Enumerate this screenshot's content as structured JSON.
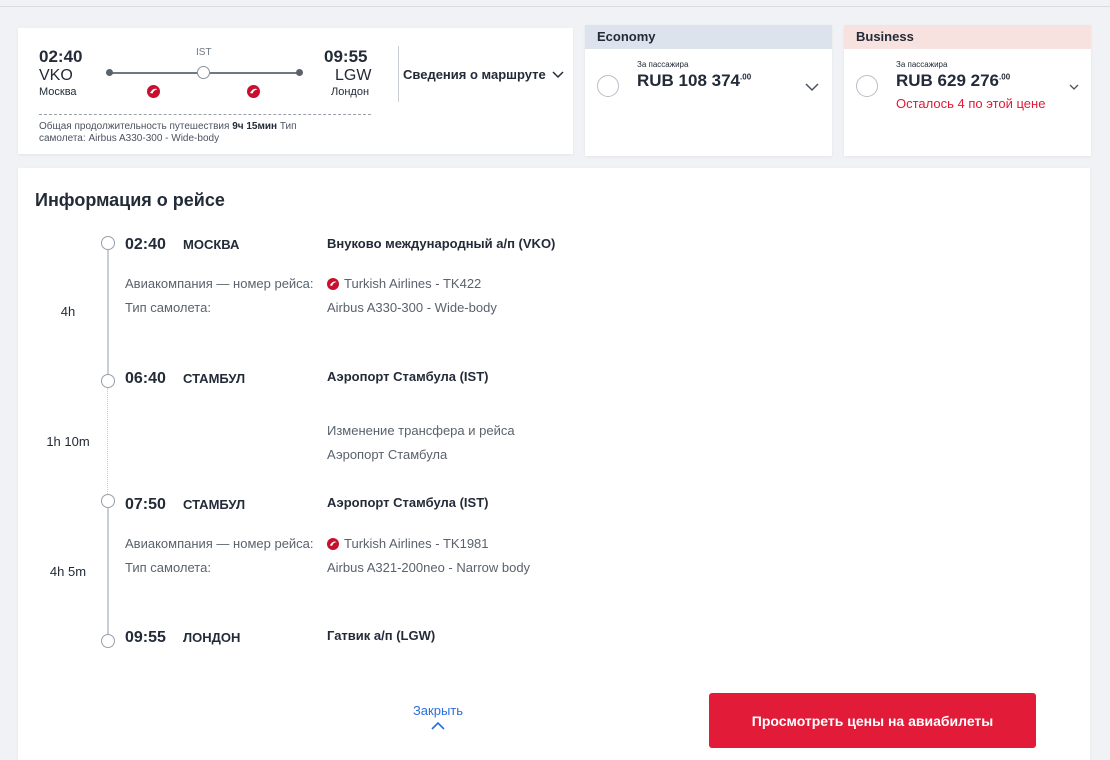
{
  "route": {
    "departure": {
      "time": "02:40",
      "code": "VKO",
      "city": "Москва"
    },
    "arrival": {
      "time": "09:55",
      "code": "LGW",
      "city": "Лондон"
    },
    "stop": "IST",
    "duration_label": "Общая продолжительность путешествия",
    "duration_value": "9ч 15мин",
    "aircraft_label": "Тип самолета:",
    "aircraft_value": "Airbus A330-300 - Wide-body",
    "details_label": "Сведения о маршруте"
  },
  "fares": {
    "economy": {
      "name": "Economy",
      "per_pax": "За пассажира",
      "price": "RUB 108 374",
      "cents": ".00"
    },
    "business": {
      "name": "Business",
      "per_pax": "За пассажира",
      "price": "RUB 629 276",
      "cents": ".00",
      "remaining": "Осталось 4 по этой цене"
    }
  },
  "info": {
    "title": "Информация о рейсе",
    "stops": [
      {
        "time": "02:40",
        "city": "Москва",
        "airport": "Внуково международный а/п (VKO)"
      },
      {
        "time": "06:40",
        "city": "Стамбул",
        "airport": "Аэропорт Стамбула (IST)"
      },
      {
        "time": "07:50",
        "city": "Стамбул",
        "airport": "Аэропорт Стамбула (IST)"
      },
      {
        "time": "09:55",
        "city": "Лондон",
        "airport": "Гатвик а/п (LGW)"
      }
    ],
    "segments": [
      {
        "duration": "4h",
        "airline_label": "Авиакомпания — номер рейса:",
        "airline": "Turkish Airlines - TK422",
        "aircraft_label": "Тип самолета:",
        "aircraft": "Airbus A330-300 - Wide-body"
      },
      {
        "duration": "4h 5m",
        "airline_label": "Авиакомпания — номер рейса:",
        "airline": "Turkish Airlines - TK1981",
        "aircraft_label": "Тип самолета:",
        "aircraft": "Airbus A321-200neo - Narrow body"
      }
    ],
    "transfer": {
      "duration": "1h 10m",
      "line1": "Изменение трансфера и рейса",
      "line2": "Аэропорт Стамбула"
    },
    "close_label": "Закрыть",
    "view_prices_label": "Просмотреть цены на авиабилеты"
  },
  "colors": {
    "accent_red": "#e11b38",
    "link_blue": "#2a6fdb",
    "economy_header": "#dde3ec",
    "business_header": "#f8e2df"
  },
  "icons": [
    "turkish-airlines-logo-icon",
    "chevron-down-icon",
    "chevron-up-icon"
  ]
}
